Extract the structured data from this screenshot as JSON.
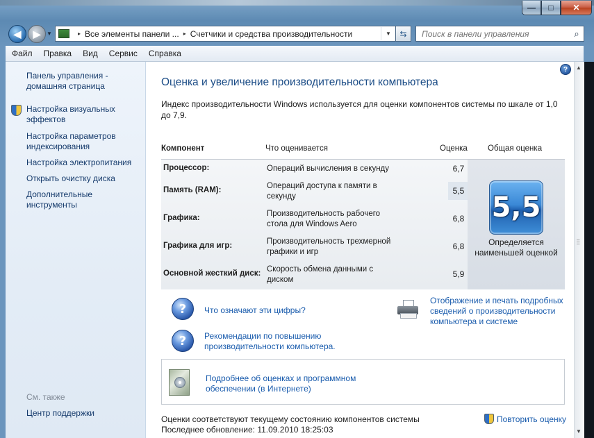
{
  "window": {
    "controls": {
      "minimize": "—",
      "maximize": "□",
      "close": "✕"
    }
  },
  "nav": {
    "back_icon": "◀",
    "forward_icon": "▶",
    "address_segments": [
      "Все элементы панели ...",
      "Счетчики и средства производительности"
    ],
    "address_separator": "▸",
    "refresh_icon": "⇆",
    "search_placeholder": "Поиск в панели управления"
  },
  "menubar": {
    "items": [
      "Файл",
      "Правка",
      "Вид",
      "Сервис",
      "Справка"
    ]
  },
  "sidebar": {
    "home_link": "Панель управления - домашняя страница",
    "links": [
      "Настройка визуальных эффектов",
      "Настройка параметров индексирования",
      "Настройка электропитания",
      "Открыть очистку диска",
      "Дополнительные инструменты"
    ],
    "see_also_label": "См. также",
    "see_also_links": [
      "Центр поддержки"
    ]
  },
  "main": {
    "title": "Оценка и увеличение производительности компьютера",
    "intro": "Индекс производительности Windows используется для оценки компонентов системы по шкале от 1,0 до 7,9.",
    "table": {
      "headers": {
        "component": "Компонент",
        "what": "Что оценивается",
        "score": "Оценка",
        "overall": "Общая оценка"
      },
      "rows": [
        {
          "component": "Процессор:",
          "what": "Операций вычисления в секунду",
          "score": "6,7"
        },
        {
          "component": "Память (RAM):",
          "what": "Операций доступа к памяти в секунду",
          "score": "5,5"
        },
        {
          "component": "Графика:",
          "what": "Производительность рабочего стола для Windows Aero",
          "score": "6,8"
        },
        {
          "component": "Графика для игр:",
          "what": "Производительность трехмерной графики и игр",
          "score": "6,8"
        },
        {
          "component": "Основной жесткий диск:",
          "what": "Скорость обмена данными с диском",
          "score": "5,9"
        }
      ],
      "overall_score": "5,5",
      "overall_caption": "Определяется наименьшей оценкой"
    },
    "links": {
      "what_numbers": "Что означают эти цифры?",
      "tips": "Рекомендации по повышению производительности компьютера.",
      "print": "Отображение и печать подробных сведений о производительности компьютера и системе"
    },
    "info_box_link": "Подробнее об оценках и программном обеспечении (в Интернете)",
    "status": "Оценки соответствуют текущему состоянию компонентов системы",
    "last_update": "Последнее обновление: 11.09.2010 18:25:03",
    "rerun": "Повторить оценку"
  }
}
